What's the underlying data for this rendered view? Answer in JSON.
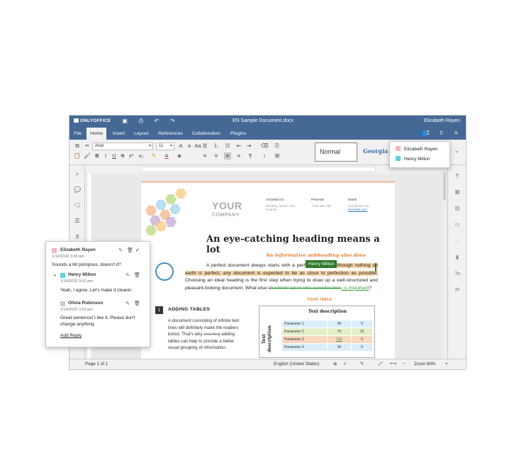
{
  "title_bar": {
    "logo": "ONLYOFFICE",
    "document_title": "EN Sample Document.docx",
    "user_name": "Elizabeth Rayen"
  },
  "menu": {
    "tabs": [
      "File",
      "Home",
      "Insert",
      "Layout",
      "References",
      "Collaboration",
      "Plugins"
    ],
    "active_tab": "Home",
    "users_count": "2"
  },
  "toolbar": {
    "font_name": "Arial",
    "font_size": "11",
    "style_normal": "Normal",
    "style_heading": "Georgia"
  },
  "users_popup": {
    "users": [
      {
        "name": "Elizabeth Rayen",
        "color": "#f4b6c8"
      },
      {
        "name": "Henry Milton",
        "color": "#5fd3d9"
      }
    ]
  },
  "document": {
    "logo_your": "YOUR",
    "logo_company": "COMPANY",
    "address_label": "ADDRESS",
    "address_value": "Building, Street, City,\nCountry",
    "phone_label": "PHONE",
    "phone_value": "+123 456 789",
    "web_label": "WEB",
    "web_value1": "you@mail.com",
    "web_value2": "arcmeds.com",
    "heading": "An eye-catching heading means a lot",
    "subheading": "An informative subheading also does",
    "para_1": "A perfect document always starts with a perfect heading.",
    "para_hl": "Although nothing on earth is perfect, any document is expected to be as close to perfection as possible.",
    "para_2": "Choosing an ideal heading is the first step when trying to draw up a well-structured and pleasant-looking document. What else",
    "para_del": "should be taken into consideration",
    "para_ins": ", is important",
    "para_end": "?",
    "tracked_user_tag": "Henry Milton",
    "section_number": "1",
    "section_title": "ADDING TABLES",
    "section_text_1": "A document consisting of infinite text lines will definitely make the readers bored. That's why",
    "section_text_strike": "inserting",
    "section_text_2": "adding tables can help to provide a better visual grouping of information.",
    "your_table_label": "YOUR TABLE",
    "table_side_label": "Text description",
    "table_header": "Text description",
    "table_rows": [
      {
        "param": "Parameter 1",
        "a": "45",
        "b": "5",
        "color": "#dbeefa"
      },
      {
        "param": "Parameter 2",
        "a": "70",
        "b": "10",
        "color": "#e4efc9"
      },
      {
        "param": "Parameter 3",
        "a": "155",
        "b": "5",
        "color": "#f9d6c0"
      },
      {
        "param": "Parameter 4",
        "a": "35",
        "b": "5",
        "color": "#dbeefa"
      }
    ]
  },
  "comments": {
    "main": {
      "author": "Elizabeth Rayen",
      "date": "1/14/2020 3:48 pm",
      "text": "Sounds a bit pompous, doesn't it?",
      "color": "#f4b6c8"
    },
    "reply_1": {
      "author": "Henry Milton",
      "date": "1/14/2020 3:52 pm",
      "text": "Yeah, I agree. Let's make it clearer.",
      "color": "#5fd3d9"
    },
    "reply_2": {
      "author": "Olivia Robinson",
      "date": "1/14/2020 3:53 pm",
      "text": "Great sentence! I like it. Please don't change anything",
      "color": "#cccccc"
    },
    "add_reply": "Add Reply"
  },
  "status_bar": {
    "page": "Page 1 of 1",
    "language": "English (United States)",
    "zoom": "Zoom 80%"
  }
}
